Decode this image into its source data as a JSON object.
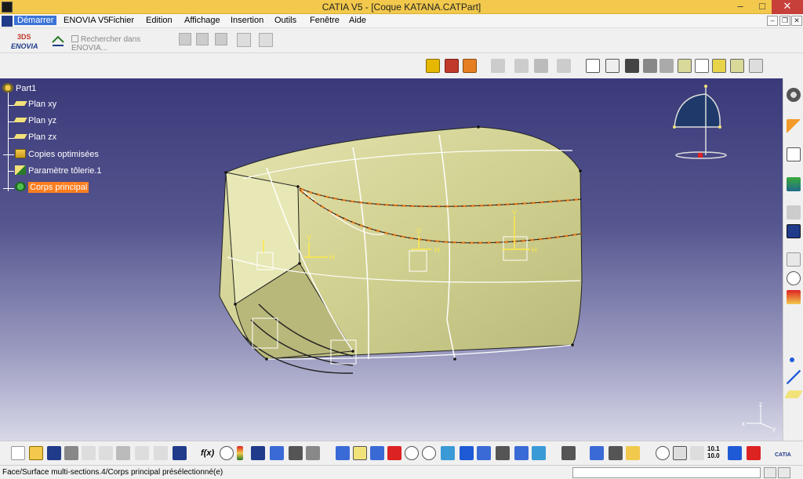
{
  "window": {
    "title": "CATIA V5 - [Coque KATANA.CATPart]",
    "minimize": "–",
    "maximize": "□",
    "close": "✕"
  },
  "menu": {
    "items": [
      "Démarrer",
      "ENOVIA V5",
      "Fichier",
      "Edition",
      "Affichage",
      "Insertion",
      "Outils",
      "Fenêtre",
      "Aide"
    ],
    "mdi_min": "–",
    "mdi_restore": "❐",
    "mdi_close": "✕"
  },
  "toolbar": {
    "logo_top": "3DS",
    "logo_text": "ENOVIA",
    "search_placeholder": "Rechercher dans ENOVIA..."
  },
  "tree": {
    "root": "Part1",
    "items": [
      {
        "label": "Plan xy",
        "icon": "plane-icon"
      },
      {
        "label": "Plan yz",
        "icon": "plane-icon"
      },
      {
        "label": "Plan zx",
        "icon": "plane-icon"
      },
      {
        "label": "Copies optimisées",
        "icon": "stack-icon"
      },
      {
        "label": "Paramètre tôlerie.1",
        "icon": "sheetmetal-icon"
      },
      {
        "label": "Corps principal",
        "icon": "body-gear-icon"
      }
    ]
  },
  "axis_labels": {
    "h": "H",
    "v": "V",
    "compass_x": "x",
    "compass_y": "y",
    "compass_z": "z"
  },
  "bottom_toolbar": {
    "fx_label": "f(x)",
    "coords_label": "10.1\n10.0",
    "catia_logo": "CATIA"
  },
  "statusbar": {
    "text": "Face/Surface multi-sections.4/Corps principal présélectionné(e)",
    "input_value": ""
  },
  "colors": {
    "selection": "#ff7d1f",
    "part_surface": "#d9d99a",
    "title_bar": "#f2c94c"
  }
}
